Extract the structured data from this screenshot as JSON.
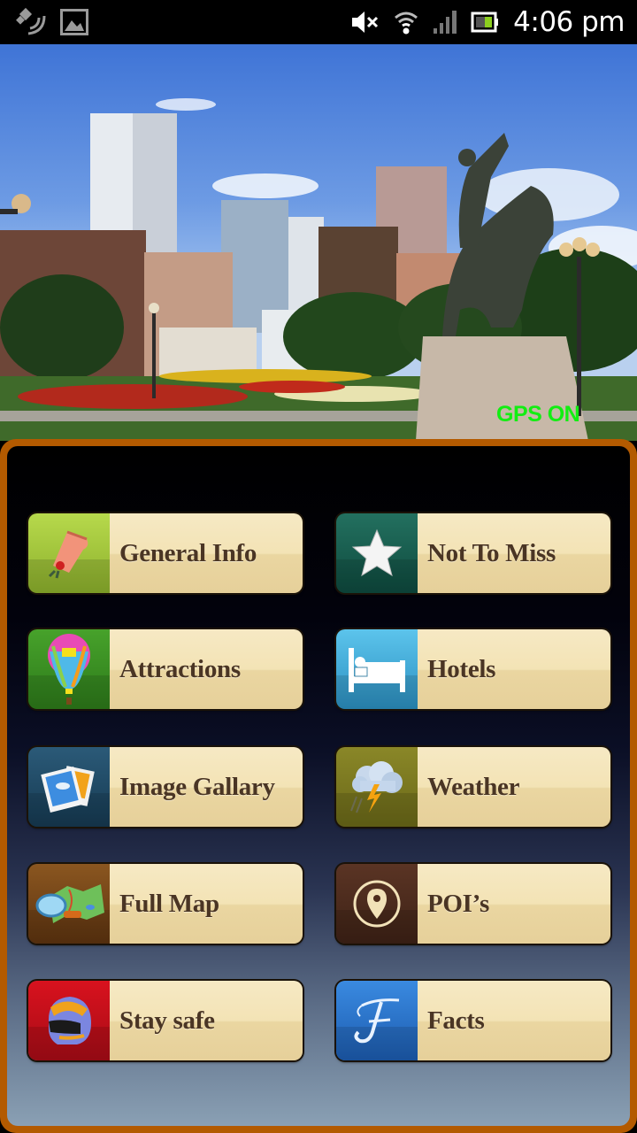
{
  "status_bar": {
    "time": "4:06 pm",
    "left_icons": [
      "gps-satellite-icon",
      "image-icon"
    ],
    "right_icons": [
      "mute-icon",
      "wifi-icon",
      "signal-icon",
      "battery-icon"
    ]
  },
  "hero": {
    "image_alt": "City skyline with bronze cowboy statue and flower gardens",
    "gps_status": "GPS ON",
    "gps_color": "#12ee12"
  },
  "menu": {
    "items": [
      {
        "label": "General Info",
        "icon": "scroll-icon",
        "color": "#9cc43a"
      },
      {
        "label": "Not To Miss",
        "icon": "star-icon",
        "color": "#1d5e52"
      },
      {
        "label": "Attractions",
        "icon": "hot-air-balloon-icon",
        "color": "#3d8f25"
      },
      {
        "label": "Hotels",
        "icon": "bed-icon",
        "color": "#3ea9d6"
      },
      {
        "label": "Image Gallary",
        "icon": "photos-icon",
        "color": "#234a66"
      },
      {
        "label": "Weather",
        "icon": "thunderstorm-icon",
        "color": "#7d7a22"
      },
      {
        "label": "Full Map",
        "icon": "map-magnifier-icon",
        "color": "#7a4816"
      },
      {
        "label": "POI’s",
        "icon": "location-pin-icon",
        "color": "#4e2c1c"
      },
      {
        "label": "Stay safe",
        "icon": "helmet-icon",
        "color": "#c4101a"
      },
      {
        "label": "Facts",
        "icon": "letter-f-icon",
        "color": "#2a73cc"
      }
    ]
  },
  "colors": {
    "panel_border": "#b35a00",
    "button_label_bg": "#f3e3b5",
    "button_text": "#4a3524"
  }
}
